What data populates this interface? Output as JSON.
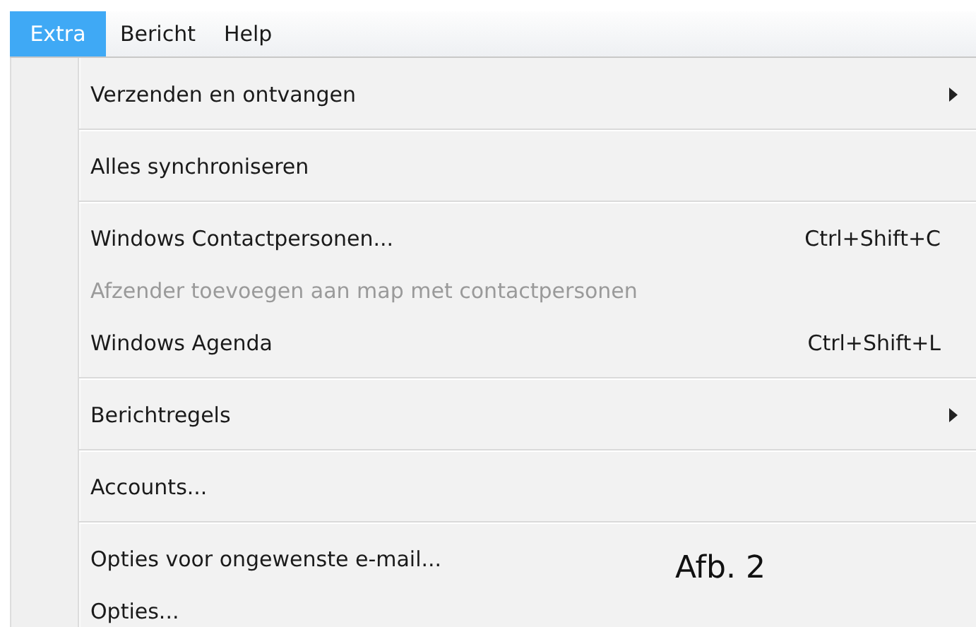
{
  "menu_bar": [
    {
      "label": "Extra",
      "selected": true
    },
    {
      "label": "Bericht",
      "selected": false
    },
    {
      "label": "Help",
      "selected": false
    }
  ],
  "menu": [
    {
      "kind": "item",
      "label": "Verzenden en ontvangen",
      "submenu": true,
      "disabled": false
    },
    {
      "kind": "separator"
    },
    {
      "kind": "item",
      "label": "Alles synchroniseren",
      "submenu": false,
      "disabled": false
    },
    {
      "kind": "separator"
    },
    {
      "kind": "item",
      "label": "Windows Contactpersonen...",
      "shortcut": "Ctrl+Shift+C",
      "submenu": false,
      "disabled": false
    },
    {
      "kind": "item",
      "label": "Afzender toevoegen aan map met contactpersonen",
      "submenu": false,
      "disabled": true
    },
    {
      "kind": "item",
      "label": "Windows Agenda",
      "shortcut": "Ctrl+Shift+L",
      "submenu": false,
      "disabled": false
    },
    {
      "kind": "separator"
    },
    {
      "kind": "item",
      "label": "Berichtregels",
      "submenu": true,
      "disabled": false
    },
    {
      "kind": "separator"
    },
    {
      "kind": "item",
      "label": "Accounts...",
      "submenu": false,
      "disabled": false
    },
    {
      "kind": "separator"
    },
    {
      "kind": "item",
      "label": "Opties voor ongewenste e-mail...",
      "submenu": false,
      "disabled": false
    },
    {
      "kind": "item",
      "label": "Opties...",
      "submenu": false,
      "disabled": false
    }
  ],
  "caption": "Afb. 2"
}
